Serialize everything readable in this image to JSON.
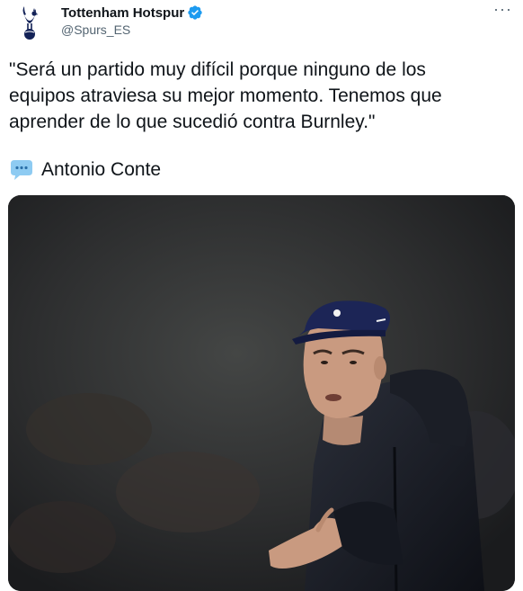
{
  "tweet": {
    "author": {
      "display_name": "Tottenham Hotspur",
      "handle": "@Spurs_ES",
      "verified": true,
      "avatar_icon": "tottenham-cockerel-logo-icon"
    },
    "more_label": "···",
    "text": "\"Será un partido muy difícil porque ninguno de los\nequipos atraviesa su mejor momento. Tenemos que\naprender de lo que sucedió contra Burnley.\"",
    "attribution": {
      "icon": "speech-bubble-icon",
      "name": "Antonio Conte"
    },
    "media": {
      "description_icon": "photo-antonio-conte"
    }
  },
  "colors": {
    "verified": "#1d9bf0",
    "text": "#0f1419",
    "secondary": "#536471",
    "bubble": "#8ecbf2"
  }
}
